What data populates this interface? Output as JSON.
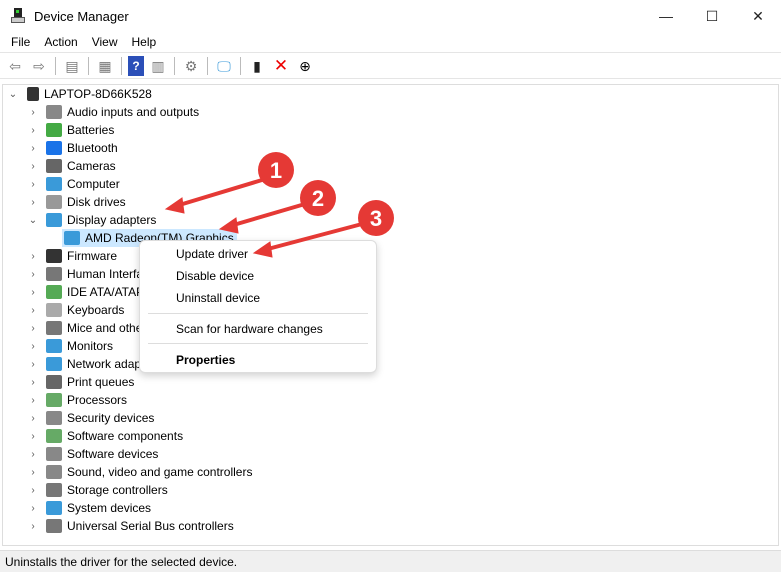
{
  "window": {
    "title": "Device Manager",
    "minimize": "—",
    "maximize": "☐",
    "close": "✕"
  },
  "menu": [
    "File",
    "Action",
    "View",
    "Help"
  ],
  "toolbar_icons": [
    "back-icon",
    "forward-icon",
    "show-hide-console-tree-icon",
    "properties-icon",
    "help-icon",
    "action-pane-icon",
    "update-driver-icon",
    "scan-hardware-icon",
    "enable-device-icon",
    "uninstall-icon",
    "disable-icon"
  ],
  "tree": {
    "root": "LAPTOP-8D66K528",
    "items": [
      {
        "label": "Audio inputs and outputs",
        "color": "#888"
      },
      {
        "label": "Batteries",
        "color": "#4a4"
      },
      {
        "label": "Bluetooth",
        "color": "#1a73e8"
      },
      {
        "label": "Cameras",
        "color": "#666"
      },
      {
        "label": "Computer",
        "color": "#3a9ad9"
      },
      {
        "label": "Disk drives",
        "color": "#999"
      },
      {
        "label": "Display adapters",
        "color": "#3a9ad9",
        "expanded": true,
        "children": [
          "AMD Radeon(TM) Graphics"
        ]
      },
      {
        "label": "Firmware",
        "color": "#333"
      },
      {
        "label": "Human Interface Devices",
        "color": "#777"
      },
      {
        "label": "IDE ATA/ATAPI controllers",
        "color": "#5a5"
      },
      {
        "label": "Keyboards",
        "color": "#aaa"
      },
      {
        "label": "Mice and other pointing devices",
        "color": "#777"
      },
      {
        "label": "Monitors",
        "color": "#3a9ad9"
      },
      {
        "label": "Network adapters",
        "color": "#3a9ad9"
      },
      {
        "label": "Print queues",
        "color": "#666"
      },
      {
        "label": "Processors",
        "color": "#6a6"
      },
      {
        "label": "Security devices",
        "color": "#888"
      },
      {
        "label": "Software components",
        "color": "#6a6"
      },
      {
        "label": "Software devices",
        "color": "#888"
      },
      {
        "label": "Sound, video and game controllers",
        "color": "#888"
      },
      {
        "label": "Storage controllers",
        "color": "#777"
      },
      {
        "label": "System devices",
        "color": "#3a9ad9"
      },
      {
        "label": "Universal Serial Bus controllers",
        "color": "#777"
      }
    ]
  },
  "context_menu": {
    "update": "Update driver",
    "disable": "Disable device",
    "uninstall": "Uninstall device",
    "scan": "Scan for hardware changes",
    "properties": "Properties"
  },
  "annotations": [
    "1",
    "2",
    "3"
  ],
  "status": "Uninstalls the driver for the selected device.",
  "accent": "#e53935"
}
